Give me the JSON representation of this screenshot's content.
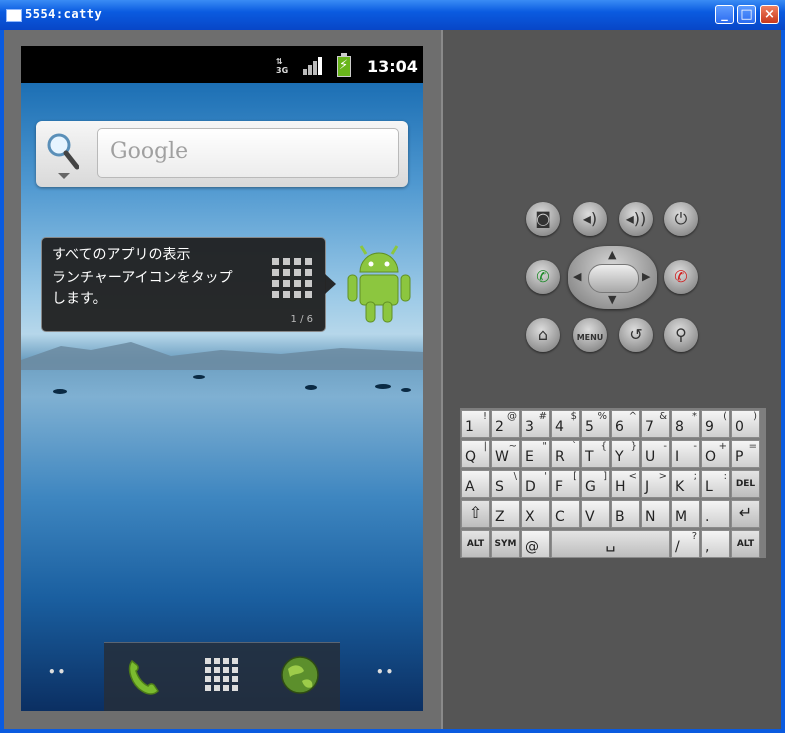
{
  "window": {
    "title": "5554:catty"
  },
  "status_bar": {
    "network": "3G",
    "time": "13:04"
  },
  "search_widget": {
    "logo": "Google"
  },
  "tooltip": {
    "line1": "すべてのアプリの表示",
    "line2": "ランチャーアイコンをタップ",
    "line3": "します。",
    "page": "1 / 6"
  },
  "hardware_buttons": {
    "menu_label": "MENU"
  },
  "keyboard": {
    "row1": [
      [
        "1",
        "!"
      ],
      [
        "2",
        "@"
      ],
      [
        "3",
        "#"
      ],
      [
        "4",
        "$"
      ],
      [
        "5",
        "%"
      ],
      [
        "6",
        "^"
      ],
      [
        "7",
        "&"
      ],
      [
        "8",
        "*"
      ],
      [
        "9",
        "("
      ],
      [
        "0",
        ")"
      ]
    ],
    "row2": [
      [
        "Q",
        "|"
      ],
      [
        "W",
        "~"
      ],
      [
        "E",
        "\""
      ],
      [
        "R",
        "`"
      ],
      [
        "T",
        "{"
      ],
      [
        "Y",
        "}"
      ],
      [
        "U",
        "-"
      ],
      [
        "I",
        "-"
      ],
      [
        "O",
        "+"
      ],
      [
        "P",
        "="
      ]
    ],
    "row3": [
      [
        "A",
        ""
      ],
      [
        "S",
        "\\"
      ],
      [
        "D",
        "'"
      ],
      [
        "F",
        "["
      ],
      [
        "G",
        "]"
      ],
      [
        "H",
        "<"
      ],
      [
        "J",
        ">"
      ],
      [
        "K",
        ";"
      ],
      [
        "L",
        ":"
      ]
    ],
    "del_label": "DEL",
    "row4": [
      [
        "Z",
        ""
      ],
      [
        "X",
        ""
      ],
      [
        "C",
        ""
      ],
      [
        "V",
        ""
      ],
      [
        "B",
        ""
      ],
      [
        "N",
        ""
      ],
      [
        "M",
        ""
      ],
      [
        ".",
        ""
      ]
    ],
    "alt_label": "ALT",
    "sym_label": "SYM",
    "at_label": "@",
    "slash_label": "/",
    "slash_alt": "?",
    "comma_label": ","
  },
  "colors": {
    "window_blue": "#0a5be0",
    "emulator_gray": "#555555",
    "battery_green": "#69b51b"
  }
}
